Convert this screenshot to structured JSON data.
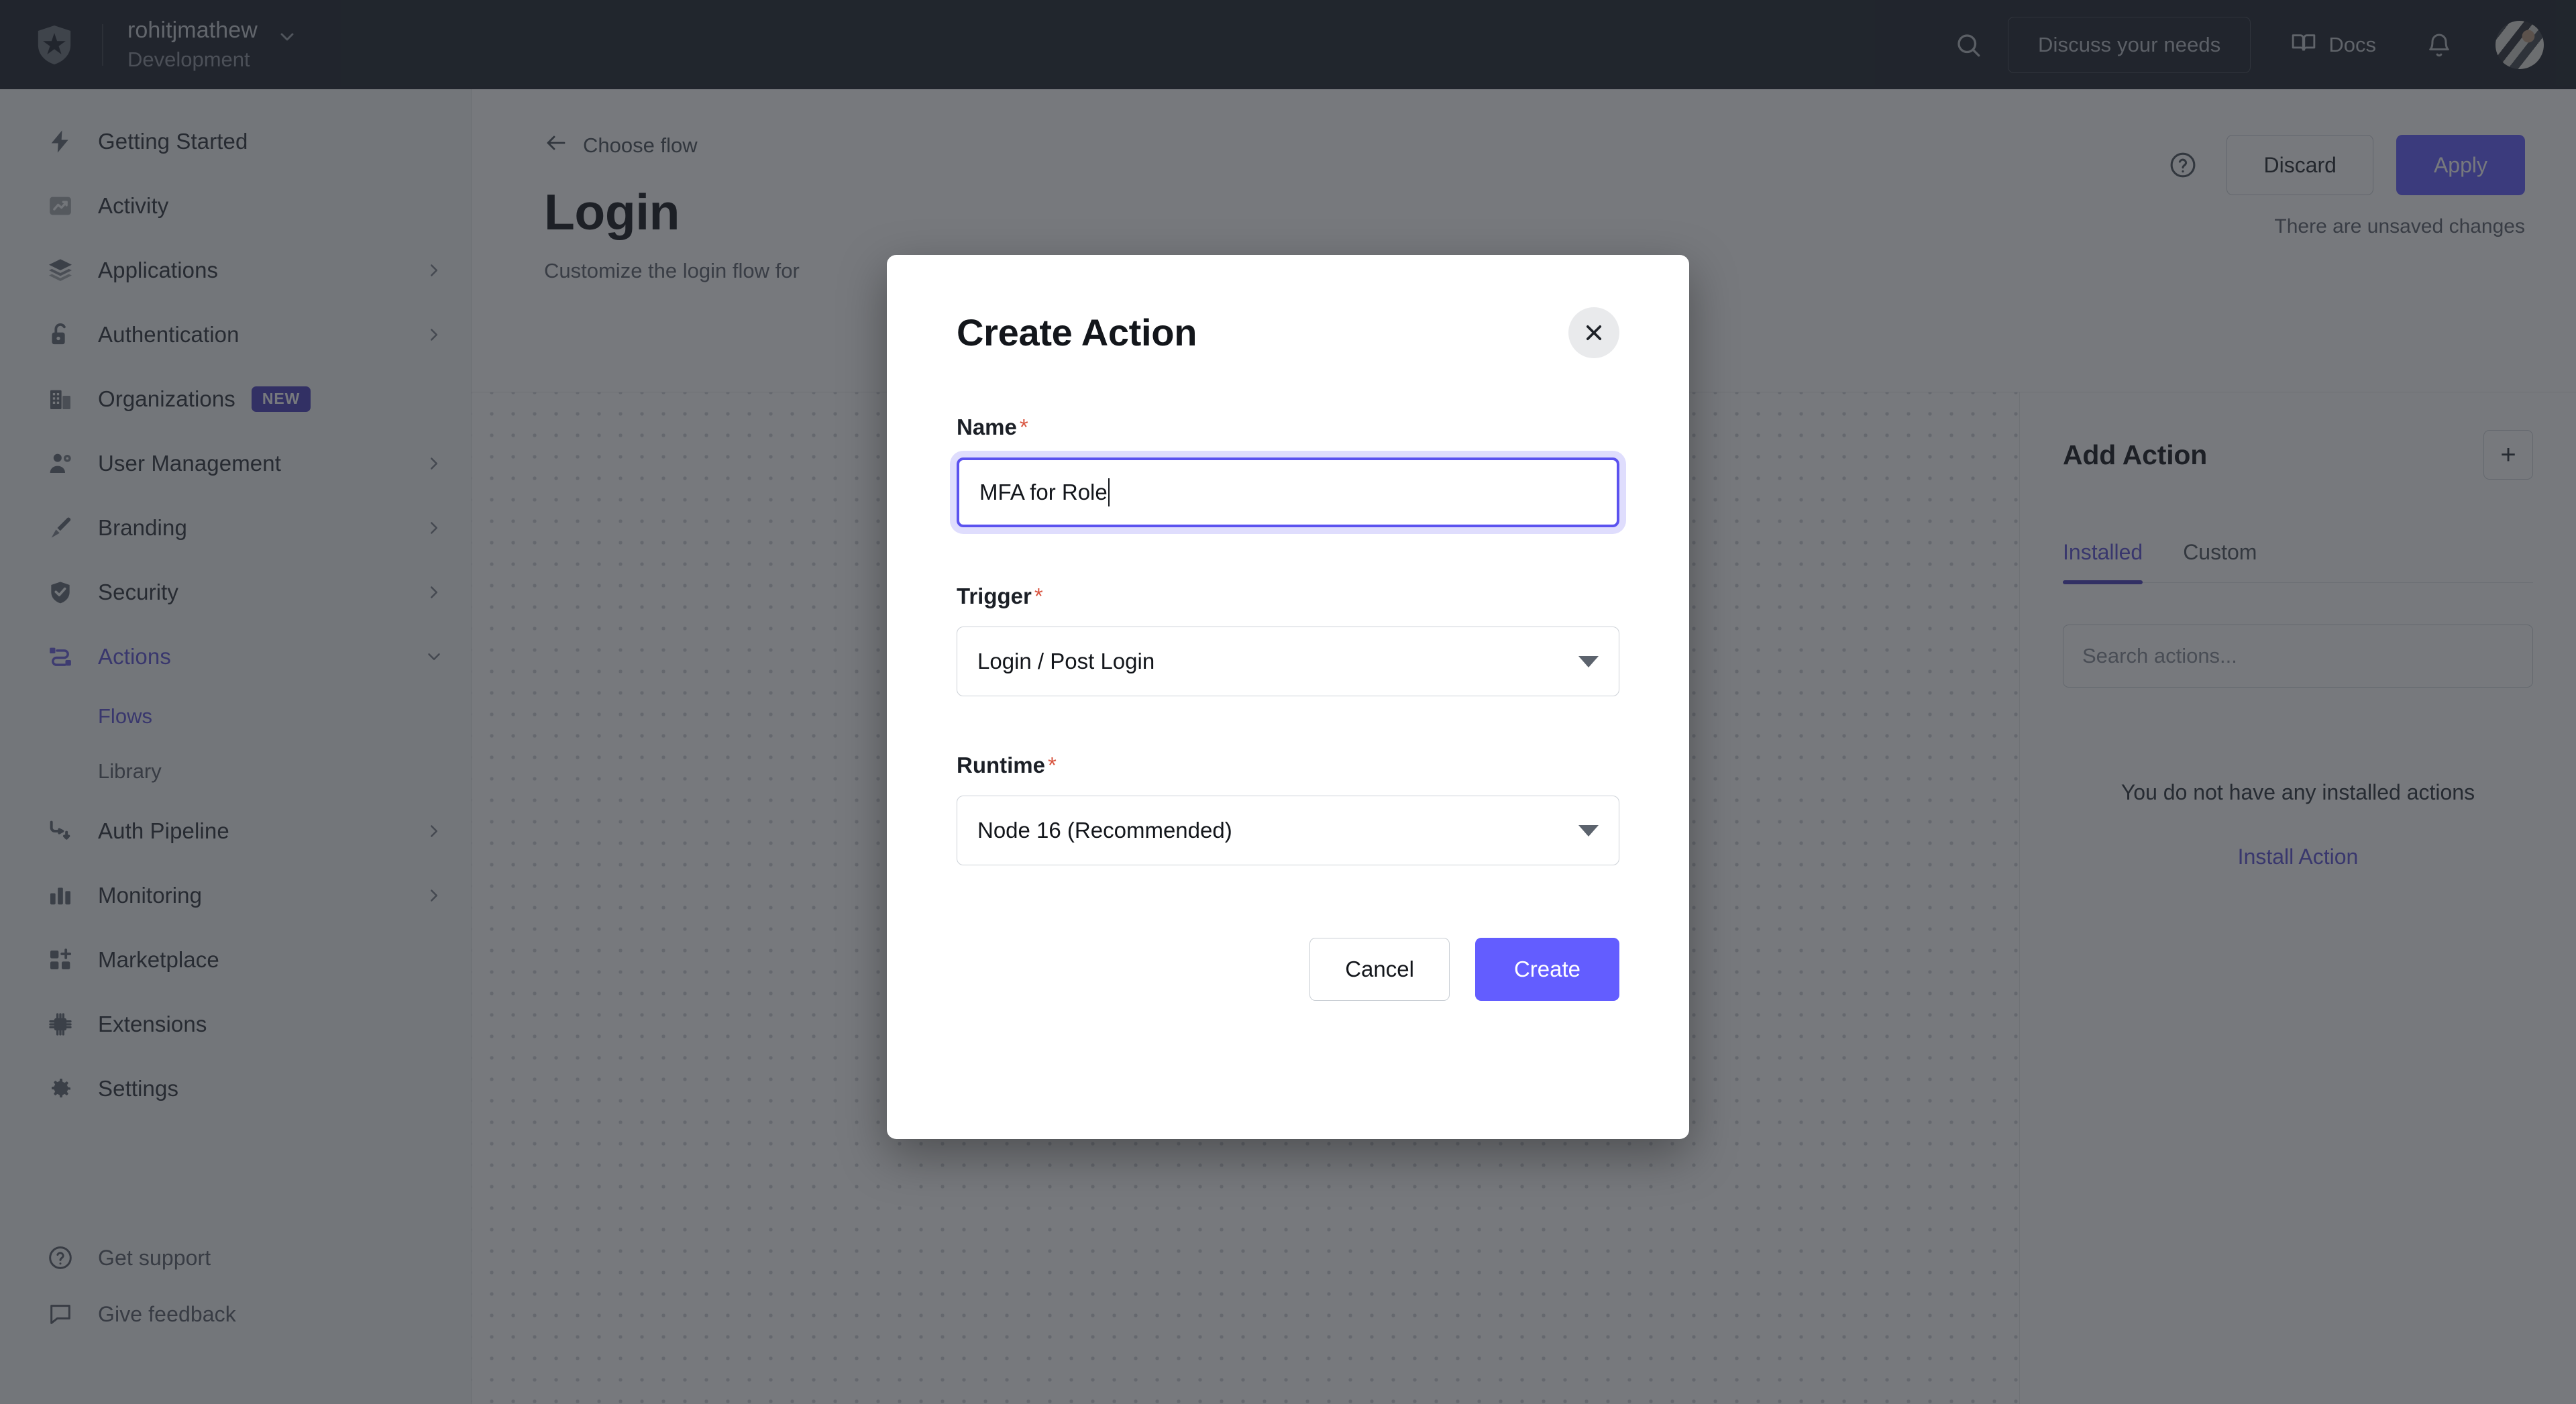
{
  "topbar": {
    "logo_icon": "auth0-shield-logo",
    "tenant_name": "rohitjmathew",
    "tenant_env": "Development",
    "tenant_caret_icon": "chevron-down-icon",
    "search_icon": "search-icon",
    "discuss_label": "Discuss your needs",
    "docs_label": "Docs",
    "docs_icon": "book-icon",
    "notifications_icon": "bell-icon",
    "avatar_icon": "user-avatar"
  },
  "sidebar": {
    "items": [
      {
        "label": "Getting Started",
        "icon": "lightning-bolt-icon",
        "chevron": false
      },
      {
        "label": "Activity",
        "icon": "trend-up-icon",
        "chevron": false
      },
      {
        "label": "Applications",
        "icon": "layers-icon",
        "chevron": true
      },
      {
        "label": "Authentication",
        "icon": "lock-icon",
        "chevron": true
      },
      {
        "label": "Organizations",
        "icon": "building-icon",
        "chevron": false,
        "badge": "NEW"
      },
      {
        "label": "User Management",
        "icon": "user-gear-icon",
        "chevron": true
      },
      {
        "label": "Branding",
        "icon": "paintbrush-icon",
        "chevron": true
      },
      {
        "label": "Security",
        "icon": "shield-check-icon",
        "chevron": true
      },
      {
        "label": "Actions",
        "icon": "actions-flow-icon",
        "chevron": true,
        "active": true,
        "expanded": true
      },
      {
        "label": "Auth Pipeline",
        "icon": "pipeline-icon",
        "chevron": true
      },
      {
        "label": "Monitoring",
        "icon": "bar-chart-icon",
        "chevron": true
      },
      {
        "label": "Marketplace",
        "icon": "grid-plus-icon",
        "chevron": false
      },
      {
        "label": "Extensions",
        "icon": "chip-icon",
        "chevron": false
      },
      {
        "label": "Settings",
        "icon": "gear-icon",
        "chevron": false
      }
    ],
    "actions_subitems": [
      {
        "label": "Flows",
        "active": true
      },
      {
        "label": "Library",
        "active": false
      }
    ],
    "bottom_items": [
      {
        "label": "Get support",
        "icon": "question-circle-icon"
      },
      {
        "label": "Give feedback",
        "icon": "chat-bubble-icon"
      }
    ]
  },
  "page": {
    "back_label": "Choose flow",
    "back_icon": "arrow-left-icon",
    "title": "Login",
    "subtitle": "Customize the login flow for",
    "help_icon": "question-circle-icon",
    "discard_label": "Discard",
    "apply_label": "Apply",
    "unsaved_note": "There are unsaved changes"
  },
  "right_panel": {
    "title": "Add Action",
    "add_button_label": "+",
    "tabs": [
      {
        "label": "Installed",
        "active": true
      },
      {
        "label": "Custom",
        "active": false
      }
    ],
    "search_placeholder": "Search actions...",
    "search_value": "",
    "empty_text": "You do not have any installed actions",
    "empty_link": "Install Action"
  },
  "modal": {
    "title": "Create Action",
    "close_icon": "close-icon",
    "name_label": "Name",
    "name_required": "*",
    "name_value": "MFA for Role",
    "trigger_label": "Trigger",
    "trigger_required": "*",
    "trigger_value": "Login / Post Login",
    "runtime_label": "Runtime",
    "runtime_required": "*",
    "runtime_value": "Node 16 (Recommended)",
    "cancel_label": "Cancel",
    "create_label": "Create"
  },
  "colors": {
    "accent_indigo": "#635dff",
    "accent_dark_indigo": "#4b3fbd",
    "header_dark": "#1f242d",
    "required_red": "#d8543f",
    "focus_border": "#5b52ef"
  }
}
